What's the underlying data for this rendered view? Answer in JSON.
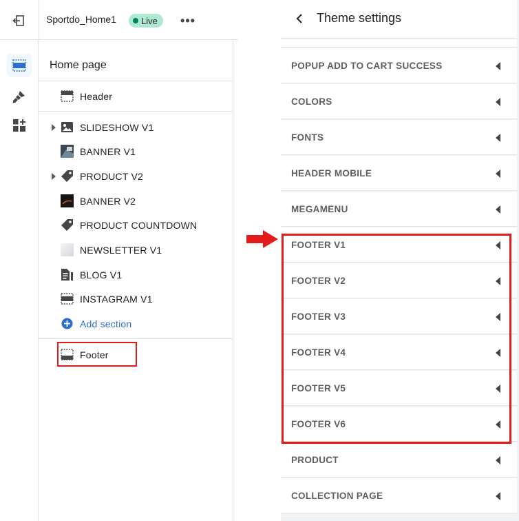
{
  "topbar": {
    "store_name": "Sportdo_Home1",
    "live_badge": "Live",
    "more_label": "•••"
  },
  "sidebar_rail": {
    "items": [
      {
        "name": "sections",
        "icon": "sections-icon",
        "active": true
      },
      {
        "name": "theme-settings",
        "icon": "brush-icon",
        "active": false
      },
      {
        "name": "apps",
        "icon": "apps-add-icon",
        "active": false
      }
    ]
  },
  "sections_panel": {
    "title": "Home page",
    "header": {
      "label": "Header",
      "icon": "header-layout-icon"
    },
    "sections": [
      {
        "label": "SLIDESHOW V1",
        "icon": "image-icon",
        "expandable": true
      },
      {
        "label": "BANNER V1",
        "icon": "banner-thumbnail",
        "expandable": false
      },
      {
        "label": "PRODUCT V2",
        "icon": "tag-icon",
        "expandable": true
      },
      {
        "label": "BANNER V2",
        "icon": "banner-thumbnail-dark",
        "expandable": false
      },
      {
        "label": "PRODUCT COUNTDOWN",
        "icon": "tag-icon",
        "expandable": false
      },
      {
        "label": "NEWSLETTER V1",
        "icon": "newsletter-thumbnail",
        "expandable": false
      },
      {
        "label": "BLOG V1",
        "icon": "blog-icon",
        "expandable": false
      },
      {
        "label": "INSTAGRAM V1",
        "icon": "layout-icon",
        "expandable": false
      }
    ],
    "add_section": {
      "label": "Add section",
      "icon": "plus-circle-icon"
    },
    "footer": {
      "label": "Footer",
      "icon": "footer-layout-icon"
    }
  },
  "theme_settings": {
    "title": "Theme settings",
    "items": [
      "POPUP ADD TO CART SUCCESS",
      "COLORS",
      "FONTS",
      "HEADER MOBILE",
      "MEGAMENU",
      "FOOTER V1",
      "FOOTER V2",
      "FOOTER V3",
      "FOOTER V4",
      "FOOTER V5",
      "FOOTER V6",
      "PRODUCT",
      "COLLECTION PAGE"
    ]
  },
  "colors": {
    "accent_blue": "#2c6ecb",
    "highlight_red": "#e41b1b",
    "live_badge_bg": "#aee9d1",
    "live_dot": "#007f5f"
  }
}
